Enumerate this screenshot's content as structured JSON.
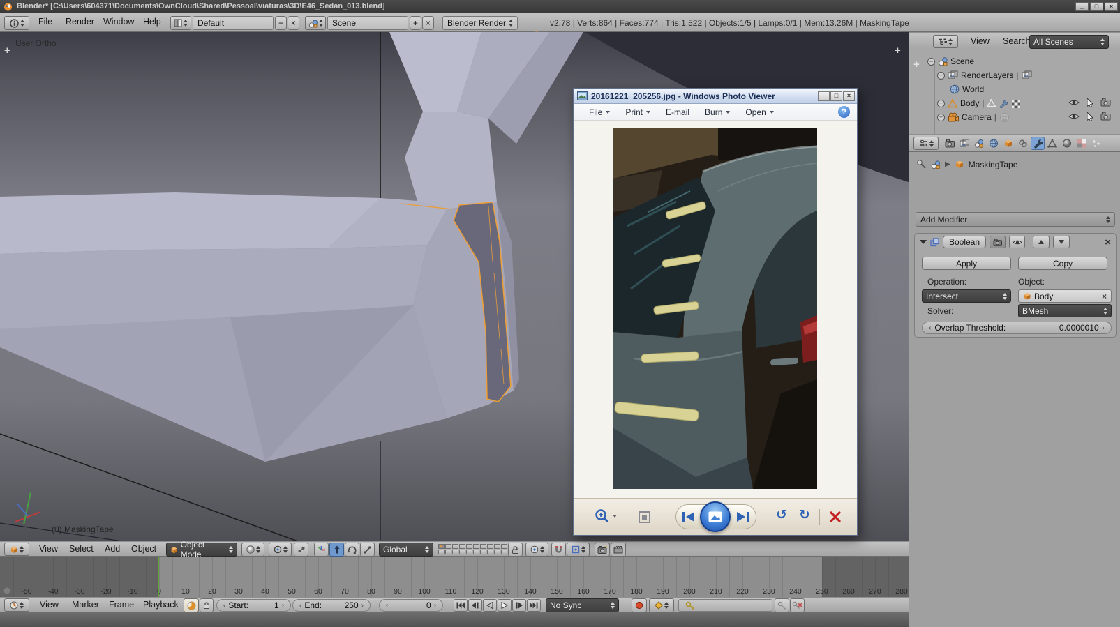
{
  "titlebar": {
    "title": "Blender* [C:\\Users\\604371\\Documents\\OwnCloud\\Shared\\Pessoal\\viaturas\\3D\\E46_Sedan_013.blend]",
    "minimize": "_",
    "maximize": "□",
    "close": "×"
  },
  "infobar": {
    "menus": [
      "File",
      "Render",
      "Window",
      "Help"
    ],
    "layout_value": "Default",
    "scene_value": "Scene",
    "engine_value": "Blender Render",
    "stats": "v2.78 | Verts:864 | Faces:774 | Tris:1,522 | Objects:1/5 | Lamps:0/1 | Mem:13.26M | MaskingTape"
  },
  "viewport": {
    "view_label": "User Ortho",
    "active_object": "(0) MaskingTape"
  },
  "photo_viewer": {
    "title": "20161221_205256.jpg - Windows Photo Viewer",
    "menus": [
      "File",
      "Print",
      "E-mail",
      "Burn",
      "Open"
    ],
    "help": "?",
    "minimize": "_",
    "maximize": "□",
    "close": "×"
  },
  "outliner": {
    "menus": [
      "View",
      "Search"
    ],
    "filter_value": "All Scenes",
    "rows": [
      {
        "label": "Scene"
      },
      {
        "label": "RenderLayers"
      },
      {
        "label": "World"
      },
      {
        "label": "Body"
      },
      {
        "label": "Camera"
      }
    ]
  },
  "properties": {
    "pinned_id": "MaskingTape",
    "add_modifier_label": "Add Modifier",
    "modifier": {
      "name": "Boolean",
      "apply_label": "Apply",
      "copy_label": "Copy",
      "operation_label": "Operation:",
      "operation_value": "Intersect",
      "object_label": "Object:",
      "object_value": "Body",
      "solver_label": "Solver:",
      "solver_value": "BMesh",
      "overlap_label": "Overlap Threshold:",
      "overlap_value": "0.0000010"
    }
  },
  "view3d_header": {
    "menus": [
      "View",
      "Select",
      "Add",
      "Object"
    ],
    "mode_value": "Object Mode",
    "orientation_value": "Global"
  },
  "timeline": {
    "menus": [
      "View",
      "Marker",
      "Frame",
      "Playback"
    ],
    "start_label": "Start:",
    "start_value": "1",
    "end_label": "End:",
    "end_value": "250",
    "current_frame": "0",
    "sync_value": "No Sync",
    "ruler": {
      "frame_labels": [
        -50,
        -40,
        -30,
        -20,
        -10,
        0,
        10,
        20,
        30,
        40,
        50,
        60,
        70,
        80,
        90,
        100,
        110,
        120,
        130,
        140,
        150,
        160,
        170,
        180,
        190,
        200,
        210,
        220,
        230,
        240,
        250,
        260,
        270,
        280
      ]
    }
  },
  "colors": {
    "accent_orange": "#e8973c",
    "selected_blue": "#7da3d4",
    "playhead_green": "#61a438",
    "tape_highlight": "#ec9f39"
  }
}
